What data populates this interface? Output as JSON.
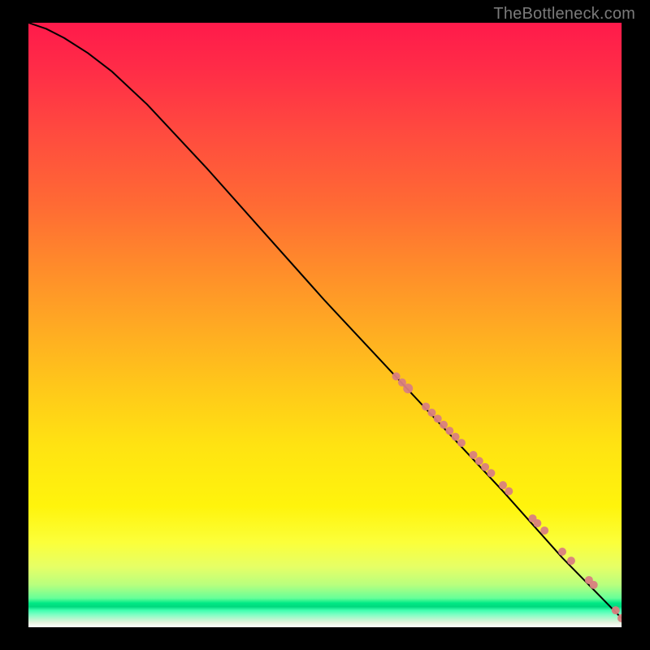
{
  "attribution": "TheBottleneck.com",
  "chart_data": {
    "type": "line",
    "title": "",
    "xlabel": "",
    "ylabel": "",
    "xlim": [
      0,
      100
    ],
    "ylim": [
      0,
      100
    ],
    "grid": false,
    "legend": false,
    "series": [
      {
        "name": "curve",
        "kind": "line",
        "color": "#000000",
        "x": [
          0,
          3,
          6,
          10,
          14,
          20,
          30,
          40,
          50,
          60,
          70,
          80,
          90,
          100
        ],
        "y": [
          100,
          99,
          97.5,
          95,
          92,
          86.5,
          76,
          65,
          54,
          43.5,
          33,
          22.5,
          11.5,
          1.5
        ]
      },
      {
        "name": "markers",
        "kind": "scatter",
        "color": "#d98080",
        "x": [
          62,
          63,
          64,
          67,
          68,
          69,
          70,
          71,
          72,
          73,
          75,
          76,
          77,
          78,
          80,
          81,
          85,
          85.8,
          87,
          90,
          91.5,
          94.5,
          95.3,
          99,
          100
        ],
        "y": [
          41.5,
          40.5,
          39.5,
          36.5,
          35.5,
          34.5,
          33.5,
          32.5,
          31.5,
          30.5,
          28.5,
          27.5,
          26.5,
          25.5,
          23.5,
          22.5,
          18,
          17.2,
          16,
          12.5,
          11,
          7.8,
          7,
          2.8,
          1.5
        ],
        "size": [
          10,
          10,
          12,
          10,
          10,
          10,
          10,
          10,
          10,
          10,
          10,
          10,
          10,
          10,
          10,
          10,
          10,
          10,
          10,
          10,
          10,
          10,
          10,
          10,
          10
        ]
      }
    ]
  }
}
